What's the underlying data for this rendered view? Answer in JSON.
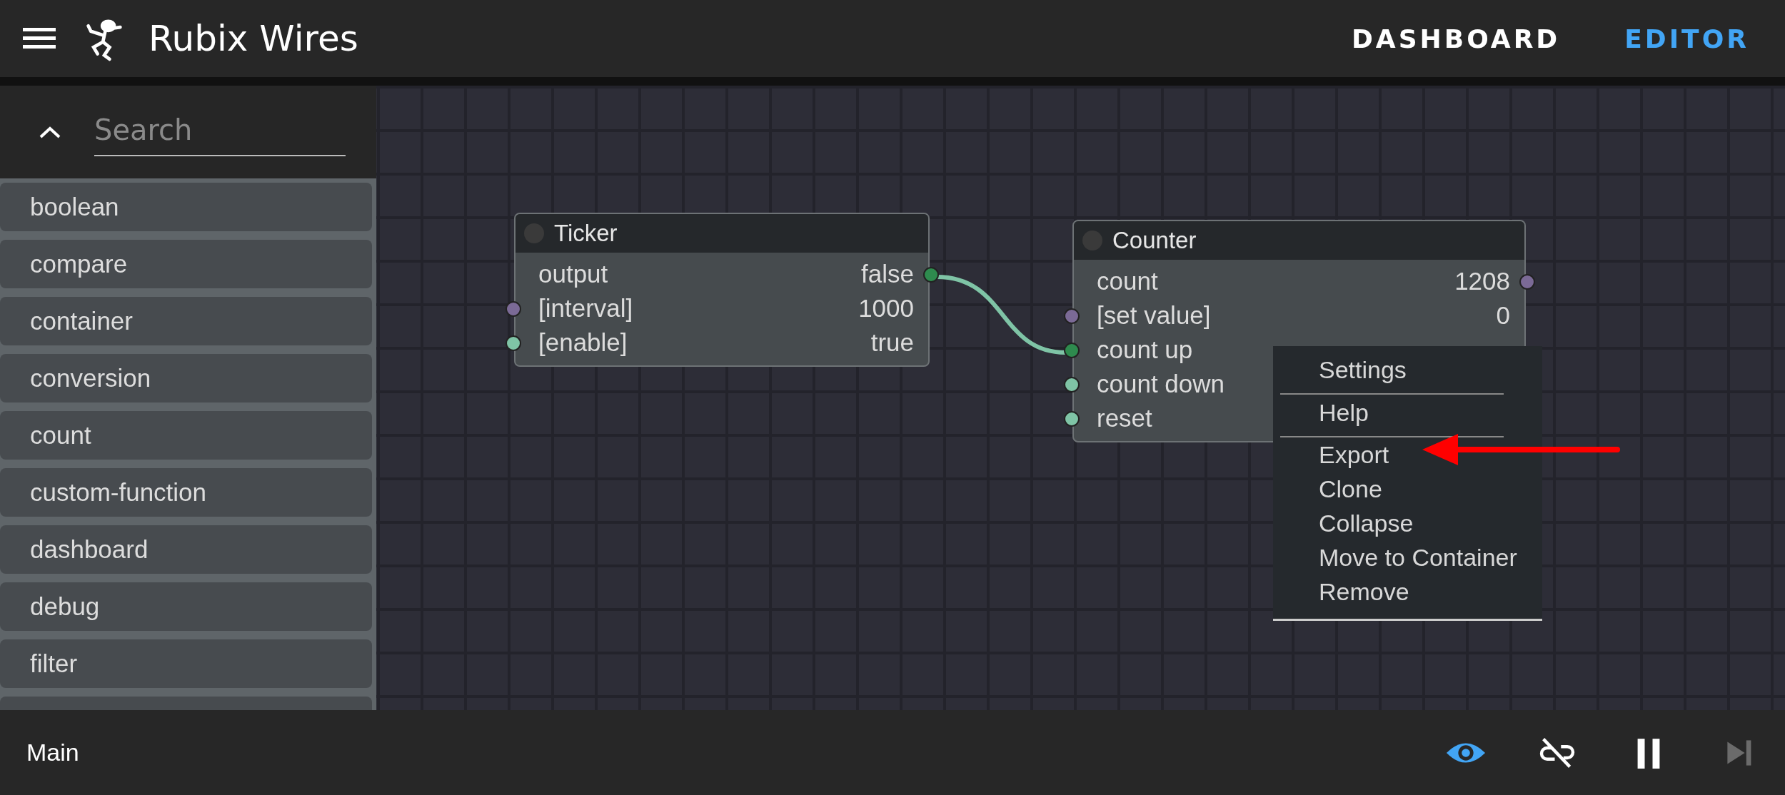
{
  "header": {
    "title": "Rubix Wires",
    "tabs": [
      {
        "label": "DASHBOARD",
        "selected": false
      },
      {
        "label": "EDITOR",
        "selected": true
      }
    ]
  },
  "sidebar": {
    "search": {
      "placeholder": "Search"
    },
    "items": [
      "boolean",
      "compare",
      "container",
      "conversion",
      "count",
      "custom-function",
      "dashboard",
      "debug",
      "filter"
    ]
  },
  "nodes": [
    {
      "title": "Ticker",
      "rows": [
        {
          "label": "output",
          "value": "false",
          "kind": "output",
          "color": "#2e8b4e"
        },
        {
          "label": "[interval]",
          "value": "1000",
          "kind": "input",
          "color": "#7b6a96"
        },
        {
          "label": "[enable]",
          "value": "true",
          "kind": "input",
          "color": "#7fc4a6"
        }
      ]
    },
    {
      "title": "Counter",
      "rows": [
        {
          "label": "count",
          "value": "1208",
          "kind": "output",
          "color": "#7b6a96"
        },
        {
          "label": "[set value]",
          "value": "0",
          "kind": "input",
          "color": "#7b6a96"
        },
        {
          "label": "count up",
          "kind": "input",
          "color": "#2e8b4e"
        },
        {
          "label": "count down",
          "kind": "input",
          "color": "#7fc4a6"
        },
        {
          "label": "reset",
          "kind": "input",
          "color": "#7fc4a6"
        }
      ]
    }
  ],
  "context_menu": {
    "items": [
      {
        "label": "Settings",
        "divider_after": true
      },
      {
        "label": "Help",
        "divider_after": true
      },
      {
        "label": "Export",
        "divider_after": false
      },
      {
        "label": "Clone",
        "divider_after": false
      },
      {
        "label": "Collapse",
        "divider_after": false
      },
      {
        "label": "Move to Container",
        "divider_after": false
      },
      {
        "label": "Remove",
        "divider_after": false
      }
    ]
  },
  "footer": {
    "label": "Main",
    "controls": [
      {
        "kind": "watch",
        "on": true,
        "disabled": false
      },
      {
        "kind": "unlink",
        "on": false,
        "disabled": false
      },
      {
        "kind": "pause",
        "on": false,
        "disabled": false
      },
      {
        "kind": "step",
        "on": false,
        "disabled": true
      }
    ]
  }
}
